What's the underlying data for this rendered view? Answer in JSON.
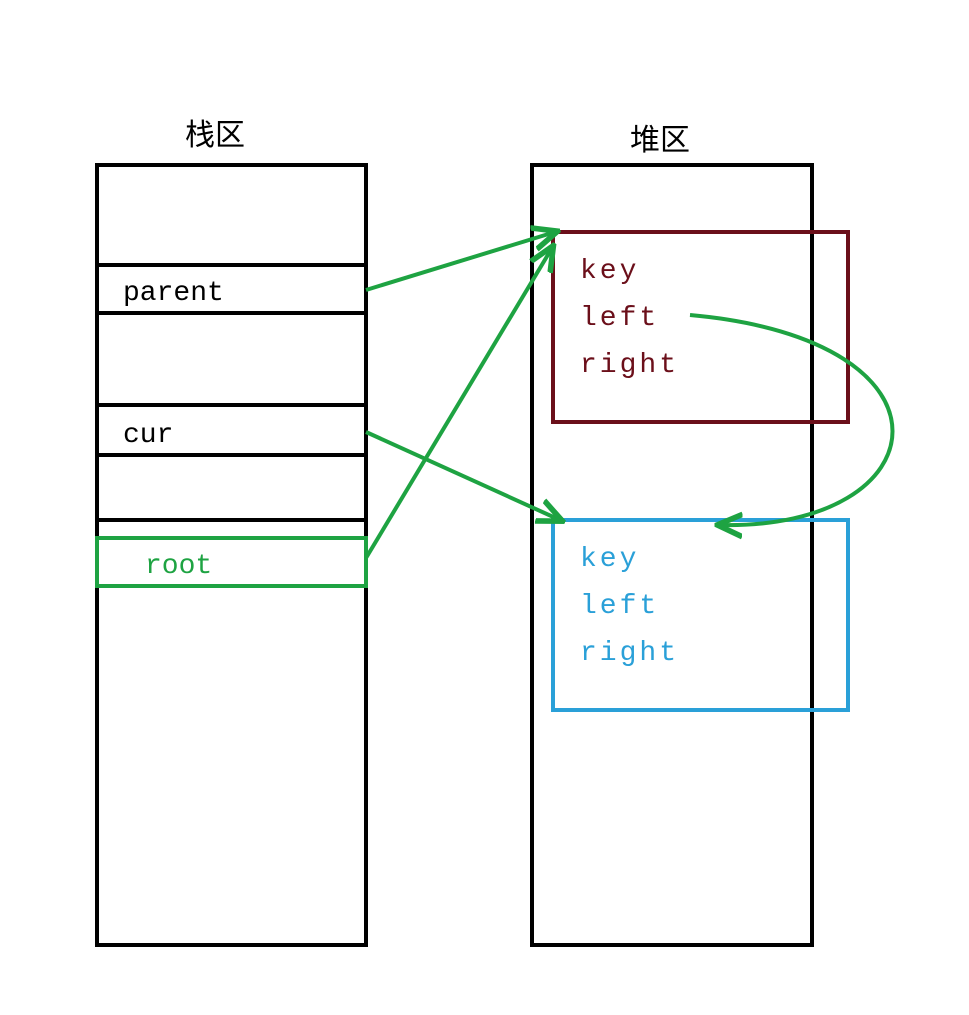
{
  "titles": {
    "stack": "栈区",
    "heap": "堆区"
  },
  "stack": {
    "parent": "parent",
    "cur": "cur",
    "root": "root"
  },
  "heap": {
    "node1": {
      "key": "key",
      "left": "left",
      "right": "right"
    },
    "node2": {
      "key": "key",
      "left": "left",
      "right": "right"
    }
  },
  "colors": {
    "black": "#000000",
    "darkred": "#6b0f1a",
    "green": "#1ea342",
    "blue": "#2aa0d8"
  }
}
